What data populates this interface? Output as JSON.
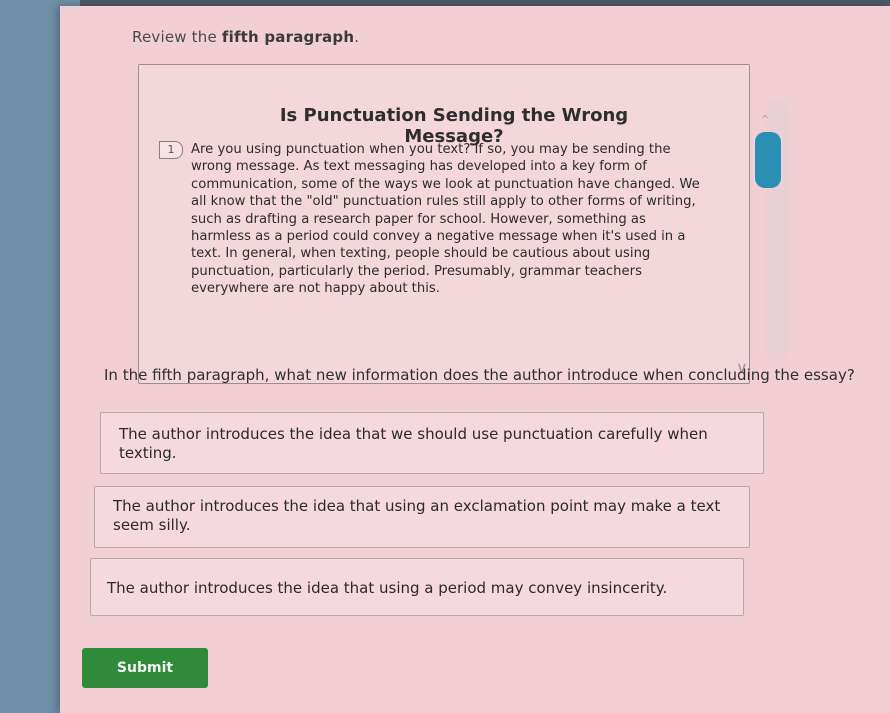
{
  "instruction": {
    "prefix": "Review the ",
    "emphasis": "fifth paragraph",
    "suffix": "."
  },
  "passage": {
    "title": "Is Punctuation Sending the Wrong Message?",
    "paragraph_number": "1",
    "text": "Are you using punctuation when you text? If so, you may be sending the wrong message. As text messaging has developed into a key form of communication, some of the ways we look at punctuation have changed. We all know that the \"old\" punctuation rules still apply to other forms of writing, such as drafting a research paper for school. However, something as harmless as a period could convey a negative message when it's used in a text. In general, when texting, people should be cautious about using punctuation, particularly the period. Presumably, grammar teachers everywhere are not happy about this."
  },
  "question": {
    "text": "In the fifth paragraph, what new information does the author introduce when concluding the essay?"
  },
  "choices": [
    {
      "text": "The author introduces the idea that we should use punctuation carefully when texting."
    },
    {
      "text": "The author introduces the idea that using an exclamation point may make a text seem silly."
    },
    {
      "text": "The author introduces the idea that using a period may convey insincerity."
    }
  ],
  "submit": {
    "label": "Submit"
  },
  "colors": {
    "scroll_thumb": "#2a8fb5",
    "submit_bg": "#2f8a3a",
    "page_bg": "#f1cfd4"
  },
  "icons": {
    "scroll_up": "chevron-up-icon",
    "scroll_down": "chevron-down-icon"
  }
}
